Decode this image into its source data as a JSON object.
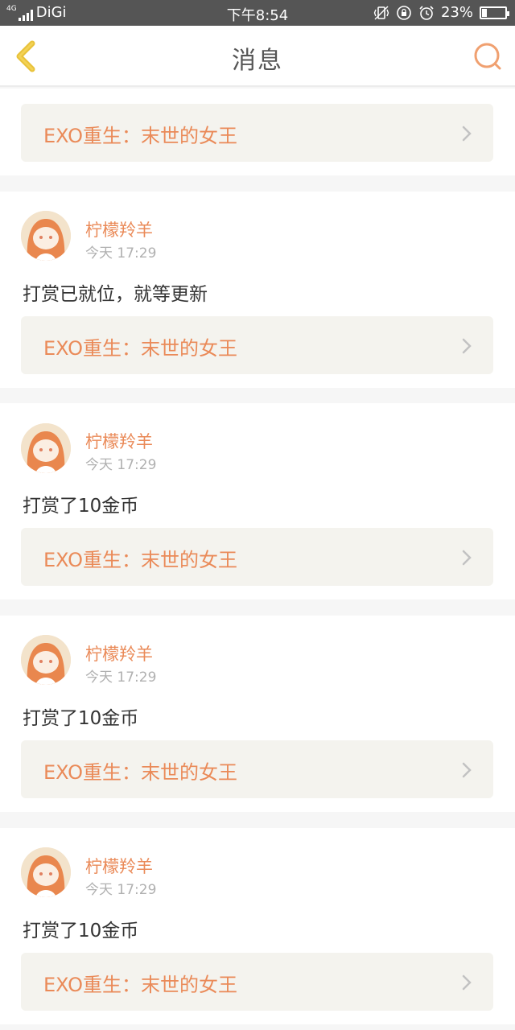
{
  "status_bar": {
    "network": "4G",
    "carrier": "DiGi",
    "time": "下午8:54",
    "battery_percent": "23%",
    "battery_level": 0.23,
    "icons": [
      "signal-icon",
      "vibrate-icon",
      "rotation-lock-icon",
      "alarm-icon",
      "battery-icon"
    ]
  },
  "header": {
    "title": "消息",
    "back_icon": "back-chevron-icon",
    "search_icon": "search-icon"
  },
  "colors": {
    "accent": "#ea8a58",
    "back_icon": "#e8c23a",
    "status_bar": "#555555",
    "book_link_bg": "#f4f3ee"
  },
  "items": [
    {
      "book_title": "EXO重生：末世的女王"
    },
    {
      "username": "柠檬羚羊",
      "time": "今天 17:29",
      "message": "打赏已就位，就等更新",
      "book_title": "EXO重生：末世的女王"
    },
    {
      "username": "柠檬羚羊",
      "time": "今天 17:29",
      "message": "打赏了10金币",
      "book_title": "EXO重生：末世的女王"
    },
    {
      "username": "柠檬羚羊",
      "time": "今天 17:29",
      "message": "打赏了10金币",
      "book_title": "EXO重生：末世的女王"
    },
    {
      "username": "柠檬羚羊",
      "time": "今天 17:29",
      "message": "打赏了10金币",
      "book_title": "EXO重生：末世的女王"
    }
  ]
}
